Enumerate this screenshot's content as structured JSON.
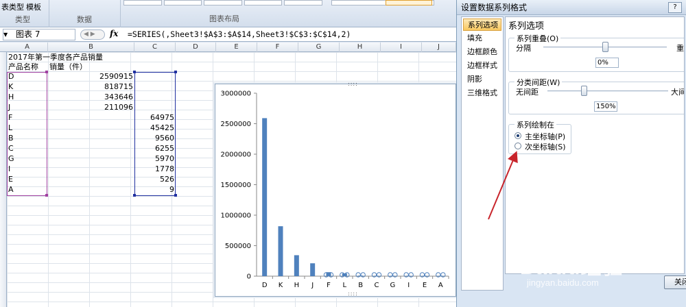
{
  "ribbon": {
    "type_buttons": [
      "表类型",
      "模板"
    ],
    "groups": [
      "类型",
      "数据",
      "图表布局"
    ]
  },
  "formula_bar": {
    "name_box": "图表 7",
    "fx": "fx",
    "formula": "=SERIES(,Sheet3!$A$3:$A$14,Sheet3!$C$3:$C$14,2)"
  },
  "sheet": {
    "columns": [
      "A",
      "B",
      "C",
      "D",
      "E",
      "F",
      "G",
      "H",
      "I",
      "J"
    ],
    "title": "2017年第一季度各产品销量",
    "header_a": "产品名称",
    "header_b": "销量（件）",
    "rows": [
      {
        "a": "D",
        "b": "2590915",
        "c": ""
      },
      {
        "a": "K",
        "b": "818715",
        "c": ""
      },
      {
        "a": "H",
        "b": "343646",
        "c": ""
      },
      {
        "a": "J",
        "b": "211096",
        "c": ""
      },
      {
        "a": "F",
        "b": "",
        "c": "64975"
      },
      {
        "a": "L",
        "b": "",
        "c": "45425"
      },
      {
        "a": "B",
        "b": "",
        "c": "9560"
      },
      {
        "a": "C",
        "b": "",
        "c": "6255"
      },
      {
        "a": "G",
        "b": "",
        "c": "5970"
      },
      {
        "a": "I",
        "b": "",
        "c": "1778"
      },
      {
        "a": "E",
        "b": "",
        "c": "526"
      },
      {
        "a": "A",
        "b": "",
        "c": "9"
      }
    ]
  },
  "chart_data": {
    "type": "bar",
    "categories": [
      "D",
      "K",
      "H",
      "J",
      "F",
      "L",
      "B",
      "C",
      "G",
      "I",
      "E",
      "A"
    ],
    "series": [
      {
        "values": [
          2590915,
          818715,
          343646,
          211096,
          0,
          0,
          0,
          0,
          0,
          0,
          0,
          0
        ]
      },
      {
        "values": [
          0,
          0,
          0,
          0,
          64975,
          45425,
          9560,
          6255,
          5970,
          1778,
          526,
          9
        ]
      }
    ],
    "y_ticks": [
      "3000000",
      "2500000",
      "2000000",
      "1500000",
      "1000000",
      "500000",
      "0"
    ],
    "ylim": [
      0,
      3000000
    ],
    "bar_color": "#4f81bd",
    "grid": false
  },
  "dialog": {
    "title": "设置数据系列格式",
    "help": "?",
    "nav": [
      "系列选项",
      "填充",
      "边框颜色",
      "边框样式",
      "阴影",
      "三维格式"
    ],
    "panel_title": "系列选项",
    "overlap": {
      "legend": "系列重叠(O)",
      "left": "分隔",
      "right": "重叠",
      "value": "0%",
      "fraction": 0.5
    },
    "gap": {
      "legend": "分类间距(W)",
      "left": "无间距",
      "right": "大间距",
      "value": "150%",
      "fraction": 0.3
    },
    "plot_on": {
      "legend": "系列绘制在",
      "primary": "主坐标轴(P)",
      "secondary": "次坐标轴(S)",
      "selected": "primary"
    },
    "close": "关闭"
  },
  "annotation": {
    "arrow_color": "#c8242b"
  },
  "watermark": {
    "main": "Baidu经验",
    "sub": "jingyan.baidu.com"
  }
}
